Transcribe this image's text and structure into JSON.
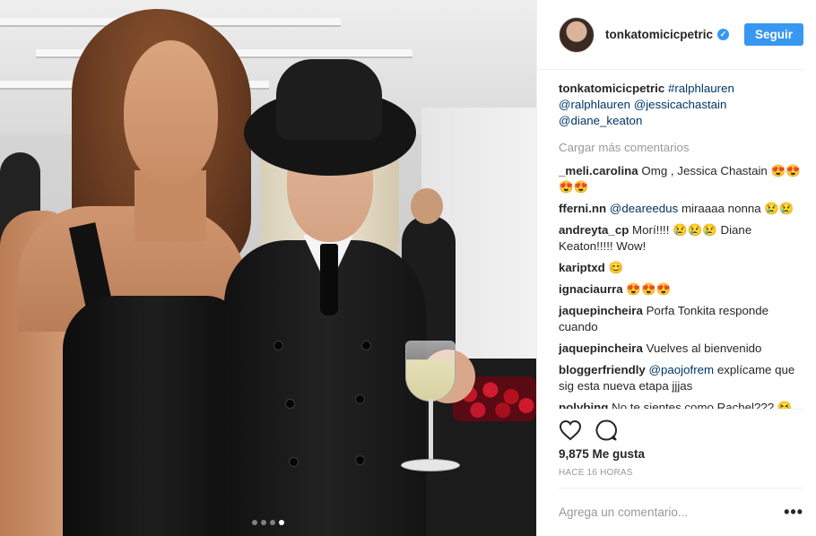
{
  "post": {
    "username": "tonkatomicicpetric",
    "follow_label": "Seguir",
    "caption": {
      "user": "tonkatomicicpetric",
      "line1": "#ralphlauren",
      "line2a": "@ralphlauren",
      "line2b": "@jessicachastain",
      "line3": "@diane_keaton"
    },
    "load_more": "Cargar más comentarios",
    "comments": [
      {
        "user": "_meli.carolina",
        "text": "Omg , Jessica Chastain 😍😍😍😍"
      },
      {
        "user": "fferni.nn",
        "mention": "@deareedus",
        "text": "miraaaa nonna 😢😢"
      },
      {
        "user": "andreyta_cp",
        "text": "Morí!!!! 😢😢😢 Diane Keaton!!!!! Wow!"
      },
      {
        "user": "kariptxd",
        "text": "😊"
      },
      {
        "user": "ignaciaurra",
        "text": "😍😍😍"
      },
      {
        "user": "jaquepincheira",
        "text": "Porfa Tonkita responde cuando"
      },
      {
        "user": "jaquepincheira",
        "text": "Vuelves al bienvenido"
      },
      {
        "user": "bloggerfriendly",
        "mention": "@paojofrem",
        "text": "explícame que sig esta nueva etapa jjjas"
      },
      {
        "user": "polybing",
        "text": "No te sientes como Rachel??? 😆"
      }
    ],
    "likes": "9,875 Me gusta",
    "timestamp": "HACE 16 HORAS",
    "add_comment_placeholder": "Agrega un comentario...",
    "more_options": "•••",
    "carousel": {
      "count": 4,
      "active_index": 3
    },
    "colors": {
      "accent": "#3897f0",
      "link": "#003569",
      "muted": "#999999"
    }
  }
}
